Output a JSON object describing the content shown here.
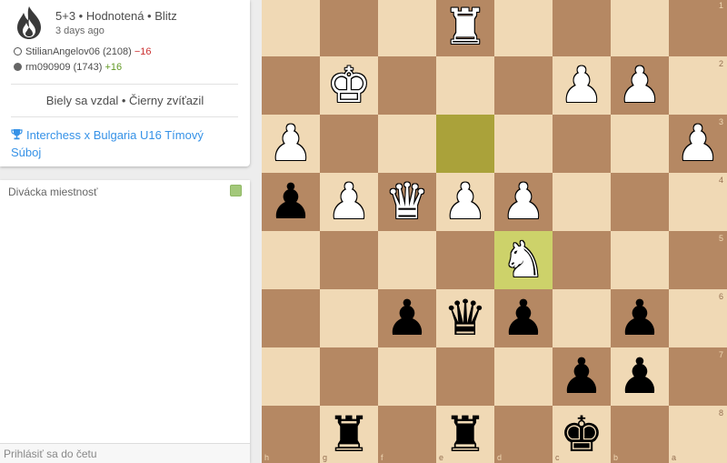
{
  "game": {
    "type": "5+3 • Hodnotená • Blitz",
    "time": "3 days ago",
    "players": [
      {
        "side": "white",
        "name": "StilianAngelov06",
        "rating": "(2108)",
        "diff": "−16",
        "diff_sign": "neg"
      },
      {
        "side": "black",
        "name": "rm090909",
        "rating": "(1743)",
        "diff": "+16",
        "diff_sign": "pos"
      }
    ],
    "result": "Biely sa vzdal • Čierny zvíťazil",
    "tournament": "Interchess x Bulgaria U16 Tímový Súboj"
  },
  "chat": {
    "title": "Divácka miestnosť",
    "placeholder": "Prihlásiť sa do četu"
  },
  "board": {
    "orientation": "black",
    "files": [
      "h",
      "g",
      "f",
      "e",
      "d",
      "c",
      "b",
      "a"
    ],
    "ranks": [
      "1",
      "2",
      "3",
      "4",
      "5",
      "6",
      "7",
      "8"
    ],
    "highlight": [
      "e3",
      "d5"
    ],
    "pieces": [
      {
        "sq": "e1",
        "color": "white",
        "type": "rook",
        "glyph": "♜"
      },
      {
        "sq": "g2",
        "color": "white",
        "type": "king",
        "glyph": "♚"
      },
      {
        "sq": "c2",
        "color": "white",
        "type": "pawn",
        "glyph": "♟"
      },
      {
        "sq": "b2",
        "color": "white",
        "type": "pawn",
        "glyph": "♟"
      },
      {
        "sq": "h3",
        "color": "white",
        "type": "pawn",
        "glyph": "♟"
      },
      {
        "sq": "a3",
        "color": "white",
        "type": "pawn",
        "glyph": "♟"
      },
      {
        "sq": "h4",
        "color": "black",
        "type": "pawn",
        "glyph": "♟"
      },
      {
        "sq": "g4",
        "color": "white",
        "type": "pawn",
        "glyph": "♟"
      },
      {
        "sq": "f4",
        "color": "white",
        "type": "queen",
        "glyph": "♛"
      },
      {
        "sq": "e4",
        "color": "white",
        "type": "pawn",
        "glyph": "♟"
      },
      {
        "sq": "d4",
        "color": "white",
        "type": "pawn",
        "glyph": "♟"
      },
      {
        "sq": "d5",
        "color": "white",
        "type": "knight",
        "glyph": "♞"
      },
      {
        "sq": "f6",
        "color": "black",
        "type": "pawn",
        "glyph": "♟"
      },
      {
        "sq": "e6",
        "color": "black",
        "type": "queen",
        "glyph": "♛"
      },
      {
        "sq": "d6",
        "color": "black",
        "type": "pawn",
        "glyph": "♟"
      },
      {
        "sq": "b6",
        "color": "black",
        "type": "pawn",
        "glyph": "♟"
      },
      {
        "sq": "c7",
        "color": "black",
        "type": "pawn",
        "glyph": "♟"
      },
      {
        "sq": "b7",
        "color": "black",
        "type": "pawn",
        "glyph": "♟"
      },
      {
        "sq": "g8",
        "color": "black",
        "type": "rook",
        "glyph": "♜"
      },
      {
        "sq": "e8",
        "color": "black",
        "type": "rook",
        "glyph": "♜"
      },
      {
        "sq": "c8",
        "color": "black",
        "type": "king",
        "glyph": "♚"
      }
    ]
  }
}
